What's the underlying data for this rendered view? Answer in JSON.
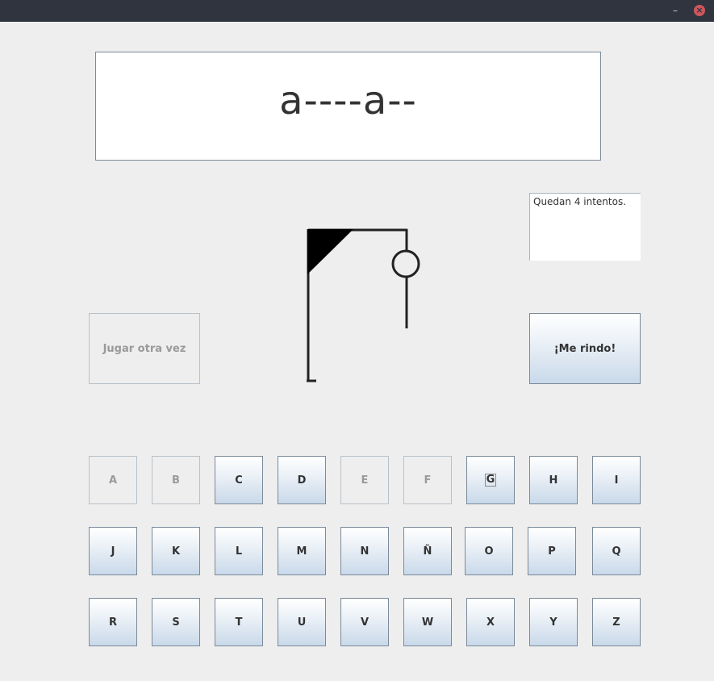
{
  "titlebar": {
    "minimize_glyph": "–",
    "close_glyph": "×"
  },
  "word": {
    "display": "a----a--"
  },
  "status": {
    "text": "Quedan 4 intentos."
  },
  "buttons": {
    "play_again": "Jugar otra vez",
    "give_up": "¡Me rindo!"
  },
  "letters": {
    "row1": [
      "A",
      "B",
      "C",
      "D",
      "E",
      "F",
      "G",
      "H",
      "I"
    ],
    "row2": [
      "J",
      "K",
      "L",
      "M",
      "N",
      "Ñ",
      "O",
      "P",
      "Q"
    ],
    "row3": [
      "R",
      "S",
      "T",
      "U",
      "V",
      "W",
      "X",
      "Y",
      "Z"
    ],
    "disabled": [
      "A",
      "B",
      "E",
      "F"
    ],
    "focused": "G"
  },
  "hangman": {
    "icon": "gallows-with-head"
  }
}
